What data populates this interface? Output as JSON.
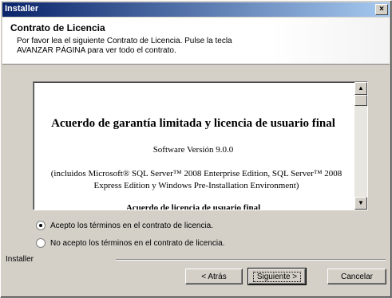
{
  "window": {
    "title": "Installer",
    "close_label": "×"
  },
  "header": {
    "title": "Contrato de Licencia",
    "description": "Por favor lea el siguiente Contrato de Licencia.  Pulse la tecla AVANZAR PÁGINA para ver todo el contrato."
  },
  "license": {
    "title": "Acuerdo de garantía limitada y licencia de usuario final",
    "version": "Software Versión 9.0.0",
    "included": "(incluidos Microsoft® SQL Server™ 2008 Enterprise Edition, SQL Server™ 2008 Express Edition y Windows Pre-Installation Environment)",
    "cut_line": "Acuerdo de licencia de usuario final"
  },
  "scrollbar": {
    "up_arrow": "▲",
    "down_arrow": "▼"
  },
  "options": {
    "accept": "Acepto los términos en el contrato de licencia.",
    "decline": "No acepto los términos en el contrato de licencia.",
    "selected": "accept"
  },
  "footer": {
    "label": "Installer",
    "back": "< Atrás",
    "next": "Siguiente >",
    "cancel": "Cancelar"
  }
}
